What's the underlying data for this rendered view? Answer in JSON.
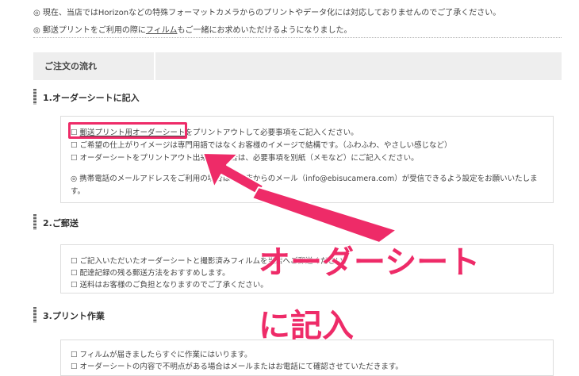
{
  "notices": [
    "◎ 現在、当店ではHorizonなどの特殊フォーマットカメラからのプリントやデータ化には対応しておりませんのでご了承ください。",
    {
      "before": "◎ 郵送プリントをご利用の際に",
      "link": "フィルム",
      "after": "もご一緒にお求めいただけるようになりました。"
    }
  ],
  "flow": {
    "title": "ご注文の流れ"
  },
  "steps": [
    {
      "title": "1.オーダーシートに記入",
      "lines": [
        {
          "prefix": "☐ ",
          "link": "郵送プリント用オーダーシート",
          "text": "をプリントアウトして必要事項をご記入ください。"
        },
        {
          "text": "☐ ご希望の仕上がりイメージは専門用語ではなくお客様のイメージで結構です。（ふわふわ、やさしい感じなど）"
        },
        {
          "text": "☐ オーダーシートをプリントアウト出来ない場合は、必要事項を別紙（メモなど）にご記入ください。"
        },
        {
          "text": "◎ 携帯電話のメールアドレスをご利用の場合は、当店からのメール（info@ebisucamera.com）が受信できるよう設定をお願いいたしま"
        },
        {
          "text": "す。"
        }
      ]
    },
    {
      "title": "2.ご郵送",
      "lines": [
        {
          "text": "☐ ご記入いただいたオーダーシートと撮影済みフィルムを当店へご郵送ください。"
        },
        {
          "text": "☐ 配達記録の残る郵送方法をおすすめします。"
        },
        {
          "text": "☐ 送料はお客様のご負担となりますのでご了承ください。"
        }
      ]
    },
    {
      "title": "3.プリント作業",
      "lines": [
        {
          "text": "☐ フィルムが届きましたらすぐに作業にはいります。"
        },
        {
          "text": "☐ オーダーシートの内容で不明点がある場合はメールまたはお電話にて確認させていただきます。"
        }
      ]
    }
  ],
  "annotation": {
    "line1": "オーダーシート",
    "line2": "に記入",
    "color": "#ee2b68"
  }
}
